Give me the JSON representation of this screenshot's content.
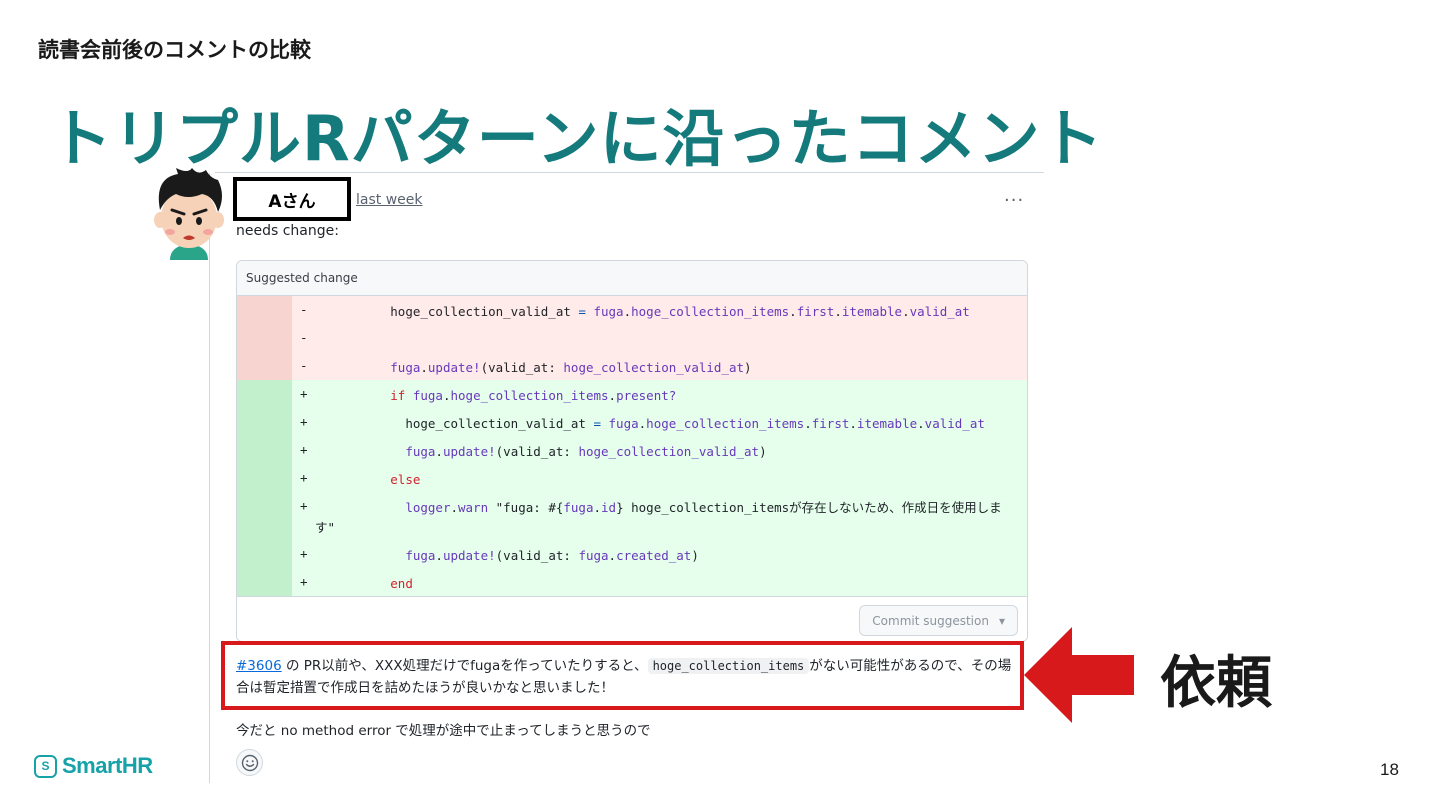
{
  "slide": {
    "section_label": "読書会前後のコメントの比較",
    "title": "トリプルRパターンに沿ったコメント",
    "annotation": "依頼",
    "page_number": "18",
    "logo_text": "SmartHR",
    "logo_mark": "S",
    "accent_color": "#157a7c",
    "highlight_color": "#d7191c"
  },
  "comment": {
    "author": "Aさん",
    "timestamp": "last week",
    "menu_icon": "kebab-horizontal-icon",
    "menu_glyph": "···",
    "intro": "needs change:",
    "suggestion": {
      "header": "Suggested change",
      "lines": [
        {
          "type": "del",
          "sign": "-",
          "segments": [
            {
              "t": "          hoge_collection_valid_at ",
              "c": ""
            },
            {
              "t": "=",
              "c": "op"
            },
            {
              "t": " ",
              "c": ""
            },
            {
              "t": "fuga",
              "c": "id"
            },
            {
              "t": ".",
              "c": ""
            },
            {
              "t": "hoge_collection_items",
              "c": "id"
            },
            {
              "t": ".",
              "c": ""
            },
            {
              "t": "first",
              "c": "id"
            },
            {
              "t": ".",
              "c": ""
            },
            {
              "t": "itemable",
              "c": "id"
            },
            {
              "t": ".",
              "c": ""
            },
            {
              "t": "valid_at",
              "c": "id"
            }
          ]
        },
        {
          "type": "del",
          "sign": "-",
          "segments": []
        },
        {
          "type": "del",
          "sign": "-",
          "segments": [
            {
              "t": "          ",
              "c": ""
            },
            {
              "t": "fuga",
              "c": "id"
            },
            {
              "t": ".",
              "c": ""
            },
            {
              "t": "update!",
              "c": "id"
            },
            {
              "t": "(valid_at: ",
              "c": ""
            },
            {
              "t": "hoge_collection_valid_at",
              "c": "id"
            },
            {
              "t": ")",
              "c": ""
            }
          ]
        },
        {
          "type": "add",
          "sign": "+",
          "segments": [
            {
              "t": "          ",
              "c": ""
            },
            {
              "t": "if",
              "c": "kw"
            },
            {
              "t": " ",
              "c": ""
            },
            {
              "t": "fuga",
              "c": "id"
            },
            {
              "t": ".",
              "c": ""
            },
            {
              "t": "hoge_collection_items",
              "c": "id"
            },
            {
              "t": ".",
              "c": ""
            },
            {
              "t": "present?",
              "c": "id"
            }
          ]
        },
        {
          "type": "add",
          "sign": "+",
          "segments": [
            {
              "t": "            hoge_collection_valid_at ",
              "c": ""
            },
            {
              "t": "=",
              "c": "op"
            },
            {
              "t": " ",
              "c": ""
            },
            {
              "t": "fuga",
              "c": "id"
            },
            {
              "t": ".",
              "c": ""
            },
            {
              "t": "hoge_collection_items",
              "c": "id"
            },
            {
              "t": ".",
              "c": ""
            },
            {
              "t": "first",
              "c": "id"
            },
            {
              "t": ".",
              "c": ""
            },
            {
              "t": "itemable",
              "c": "id"
            },
            {
              "t": ".",
              "c": ""
            },
            {
              "t": "valid_at",
              "c": "id"
            }
          ]
        },
        {
          "type": "add",
          "sign": "+",
          "segments": [
            {
              "t": "            ",
              "c": ""
            },
            {
              "t": "fuga",
              "c": "id"
            },
            {
              "t": ".",
              "c": ""
            },
            {
              "t": "update!",
              "c": "id"
            },
            {
              "t": "(valid_at: ",
              "c": ""
            },
            {
              "t": "hoge_collection_valid_at",
              "c": "id"
            },
            {
              "t": ")",
              "c": ""
            }
          ]
        },
        {
          "type": "add",
          "sign": "+",
          "segments": [
            {
              "t": "          ",
              "c": ""
            },
            {
              "t": "else",
              "c": "kw"
            }
          ]
        },
        {
          "type": "add",
          "sign": "+",
          "tall": true,
          "segments": [
            {
              "t": "            ",
              "c": ""
            },
            {
              "t": "logger",
              "c": "id"
            },
            {
              "t": ".",
              "c": ""
            },
            {
              "t": "warn",
              "c": "id"
            },
            {
              "t": " \"fuga: #{",
              "c": ""
            },
            {
              "t": "fuga",
              "c": "id"
            },
            {
              "t": ".",
              "c": ""
            },
            {
              "t": "id",
              "c": "id"
            },
            {
              "t": "} hoge_collection_itemsが存在しないため、作成日を使用します\"",
              "c": ""
            }
          ]
        },
        {
          "type": "add",
          "sign": "+",
          "segments": [
            {
              "t": "            ",
              "c": ""
            },
            {
              "t": "fuga",
              "c": "id"
            },
            {
              "t": ".",
              "c": ""
            },
            {
              "t": "update!",
              "c": "id"
            },
            {
              "t": "(valid_at: ",
              "c": ""
            },
            {
              "t": "fuga",
              "c": "id"
            },
            {
              "t": ".",
              "c": ""
            },
            {
              "t": "created_at",
              "c": "id"
            },
            {
              "t": ")",
              "c": ""
            }
          ]
        },
        {
          "type": "add",
          "sign": "+",
          "segments": [
            {
              "t": "          ",
              "c": ""
            },
            {
              "t": "end",
              "c": "kw"
            }
          ]
        }
      ],
      "commit_button": "Commit suggestion",
      "commit_caret": "▾"
    },
    "body": {
      "issue_link": "#3606",
      "text_before": " の PR以前や、XXX処理だけでfugaを作っていたりすると、",
      "inline_code": "hoge_collection_items",
      "text_after": "がない可能性があるので、その場合は暫定措置で作成日を詰めたほうが良いかなと思いました！"
    },
    "extra": "今だと no method error で処理が途中で止まってしまうと思うので",
    "reaction_icon": "smiley-icon"
  }
}
